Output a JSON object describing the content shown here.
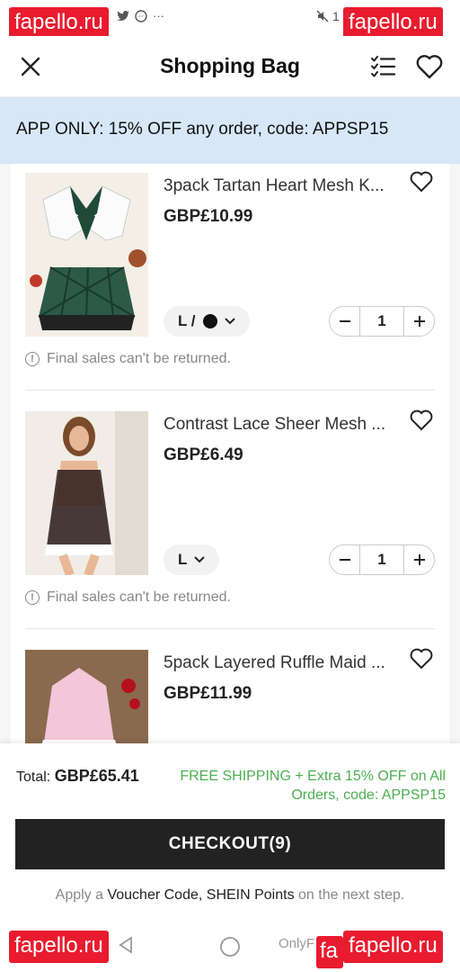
{
  "status_bar": {
    "left_icons": [
      "twitter-icon",
      "messenger-icon",
      "more-icon"
    ],
    "right_text": "1"
  },
  "watermark": "fapello.ru",
  "header": {
    "title": "Shopping Bag"
  },
  "promo": {
    "text": "APP ONLY: 15% OFF any order, code: APPSP15"
  },
  "items": [
    {
      "name": "3pack Tartan Heart Mesh K...",
      "price": "GBP£10.99",
      "variant_size": "L /",
      "variant_color": "#111111",
      "quantity": "1",
      "note": "Final sales can't be returned."
    },
    {
      "name": "Contrast Lace Sheer Mesh ...",
      "price": "GBP£6.49",
      "variant_size": "L",
      "quantity": "1",
      "note": "Final sales can't be returned."
    },
    {
      "name": "5pack Layered Ruffle Maid ...",
      "price": "GBP£11.99"
    }
  ],
  "footer": {
    "total_label": "Total:",
    "total_value": "GBP£65.41",
    "shipping_line1": "FREE SHIPPING + Extra 15% OFF on All",
    "shipping_line2": "Orders, code: APPSP15",
    "checkout_label": "CHECKOUT(9)",
    "hint_prefix": "Apply a",
    "hint_voucher": "Voucher Code, SHEIN Points",
    "hint_suffix": "on the next step."
  },
  "navbar": {
    "text": "OnlyF"
  },
  "colors": {
    "promo_bg": "#d7e7f8",
    "shipping_green": "#4caf50",
    "checkout_bg": "#222222",
    "watermark_red": "#e81c2e"
  }
}
